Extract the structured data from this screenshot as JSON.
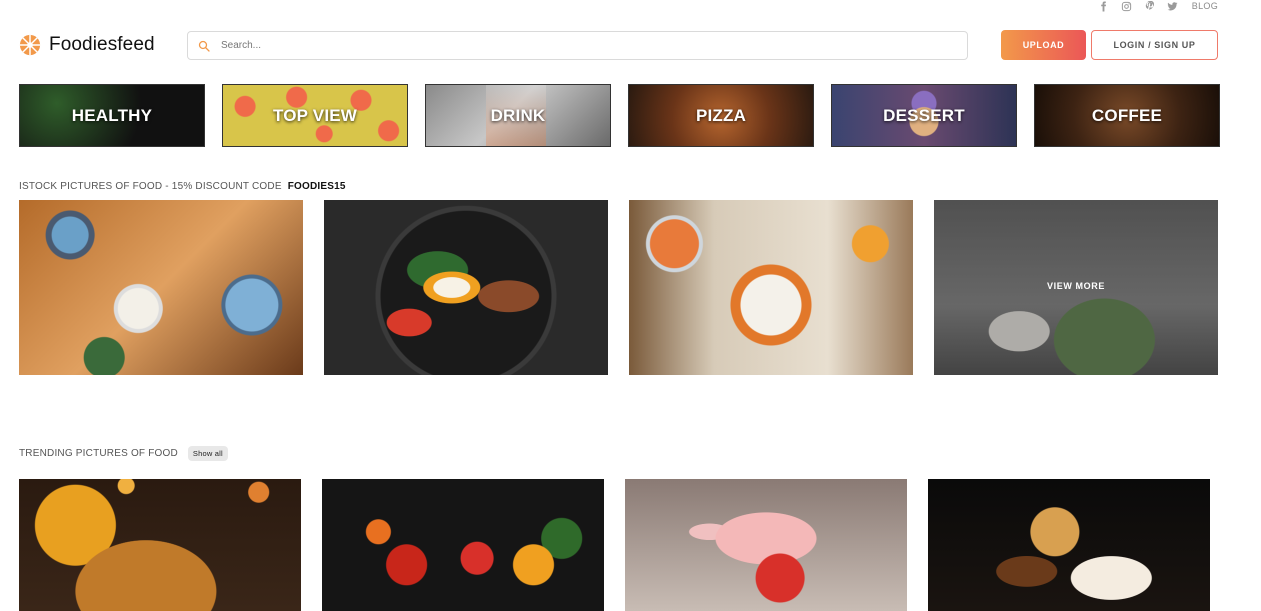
{
  "social": {
    "icons": [
      "facebook-icon",
      "instagram-icon",
      "pinterest-icon",
      "twitter-icon"
    ],
    "blog_label": "BLOG"
  },
  "header": {
    "logo_text": "Foodiesfeed",
    "search_placeholder": "Search...",
    "upload_label": "UPLOAD",
    "login_label": "LOGIN / SIGN UP"
  },
  "colors": {
    "accent_start": "#f2994a",
    "accent_end": "#eb5757",
    "logo_orange": "#f2994a"
  },
  "categories": [
    {
      "label": "HEALTHY"
    },
    {
      "label": "TOP VIEW"
    },
    {
      "label": "DRINK"
    },
    {
      "label": "PIZZA"
    },
    {
      "label": "DESSERT"
    },
    {
      "label": "COFFEE"
    }
  ],
  "istock": {
    "label": "ISTOCK PICTURES OF FOOD - 15% DISCOUNT CODE",
    "code": "FOODIES15",
    "view_more_label": "VIEW MORE"
  },
  "trending": {
    "label": "TRENDING PICTURES OF FOOD",
    "show_all_label": "Show all"
  }
}
